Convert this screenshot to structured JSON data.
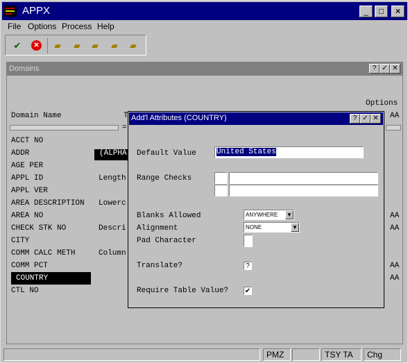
{
  "app": {
    "title": "APPX",
    "window_buttons": [
      "_",
      "□",
      "×"
    ]
  },
  "menu": [
    "File",
    "Options",
    "Process",
    "Help"
  ],
  "toolbar": {
    "tools": [
      "check-icon",
      "cancel-icon",
      "add-folder-icon",
      "edit-folder-icon",
      "search-folder-icon",
      "delete-folder-icon",
      "folder-check-icon"
    ]
  },
  "domains_window": {
    "title": "Domains",
    "header_options": "Options",
    "header_domain_name": "Domain Name",
    "header_t": "T",
    "header_aa": "AA",
    "header_eq": "=",
    "items": [
      {
        "name": "ACCT NO",
        "desc": "",
        "right": ""
      },
      {
        "name": "ADDR",
        "desc": "(ALPHA",
        "right": ""
      },
      {
        "name": "AGE PER",
        "desc": "",
        "right": ""
      },
      {
        "name": "APPL ID",
        "desc": "Length",
        "right": ""
      },
      {
        "name": "APPL VER",
        "desc": "",
        "right": ""
      },
      {
        "name": "AREA DESCRIPTION",
        "desc": "Lowerc",
        "right": ""
      },
      {
        "name": "AREA NO",
        "desc": "",
        "right": "AA"
      },
      {
        "name": "CHECK STK NO",
        "desc": "Descri",
        "right": "AA"
      },
      {
        "name": "CITY",
        "desc": "",
        "right": ""
      },
      {
        "name": "COMM CALC METH",
        "desc": "Column",
        "right": ""
      },
      {
        "name": "COMM PCT",
        "desc": "",
        "right": "AA"
      },
      {
        "name": "COUNTRY",
        "desc": "",
        "right": "AA"
      },
      {
        "name": "CTL NO",
        "desc": "",
        "right": ""
      }
    ]
  },
  "dialog": {
    "title": "Add'l Attributes (COUNTRY)",
    "default_value_label": "Default Value",
    "default_value": "United States",
    "range_checks_label": "Range Checks",
    "blanks_allowed_label": "Blanks Allowed",
    "blanks_allowed_value": "ANYWHERE",
    "alignment_label": "Alignment",
    "alignment_value": "NONE",
    "pad_character_label": "Pad Character",
    "translate_label": "Translate?",
    "translate_value": "?",
    "require_table_label": "Require Table Value?",
    "require_table_checked": "✔"
  },
  "status": {
    "cells": [
      "PMZ",
      "",
      "TSY TA",
      "Chg"
    ]
  }
}
